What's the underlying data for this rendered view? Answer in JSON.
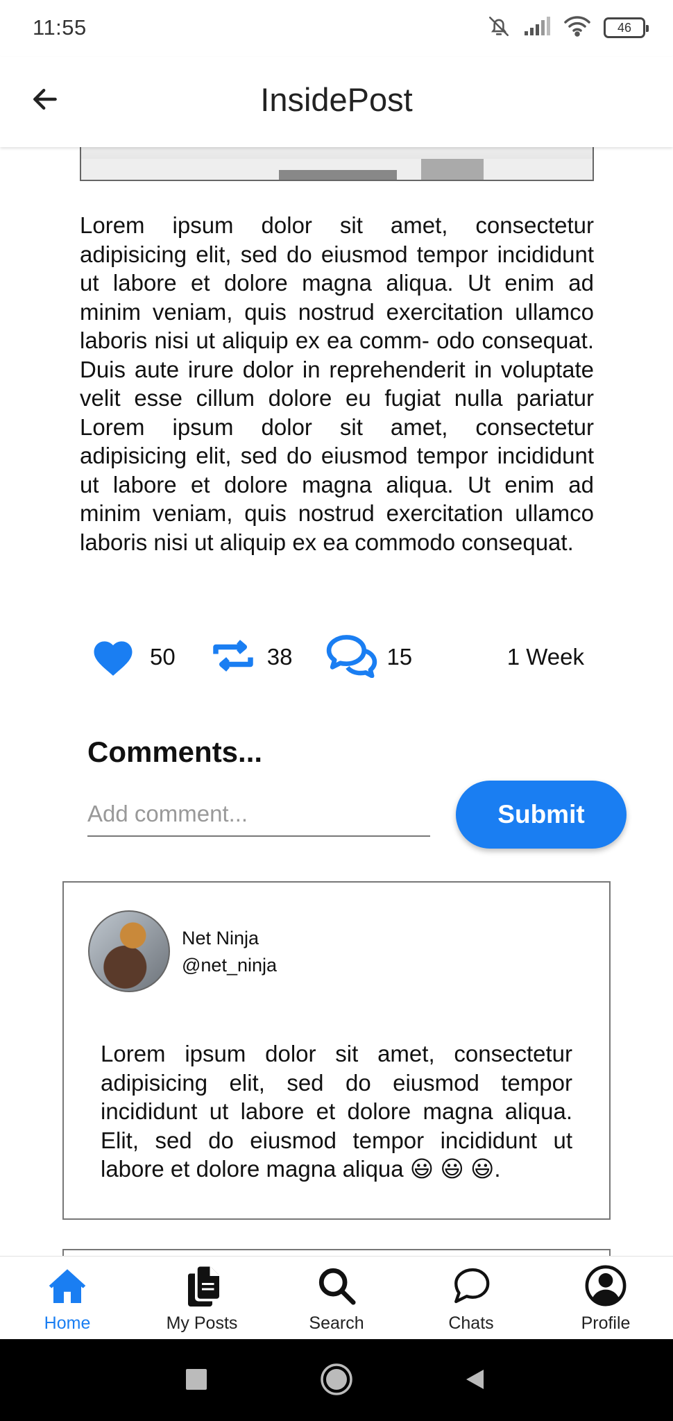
{
  "status_bar": {
    "time": "11:55",
    "battery_level": "46",
    "icons": [
      "bell-off-icon",
      "signal-icon",
      "wifi-icon",
      "battery-icon"
    ]
  },
  "app_bar": {
    "title": "InsidePost",
    "back_icon": "arrow-left-icon"
  },
  "post": {
    "body": "Lorem ipsum dolor sit amet, consectetur adipisicing elit, sed do eiusmod tempor incididunt ut labore et dolore magna aliqua. Ut enim ad minim veniam, quis nostrud exercitation ullamco laboris nisi ut aliquip ex ea comm- odo consequat. Duis aute irure dolor in reprehenderit in voluptate velit esse cillum dolore eu fugiat nulla pariatur Lorem ipsum dolor sit amet, consectetur adipisicing elit, sed do eiusmod tempor incididunt ut labore et dolore magna aliqua. Ut enim ad minim veniam, quis nostrud exercitation ullamco laboris nisi ut aliquip ex ea commodo consequat.",
    "likes": "50",
    "reposts": "38",
    "comments": "15",
    "time_ago": "1 Week"
  },
  "comments_section": {
    "heading": "Comments...",
    "input_placeholder": "Add comment...",
    "input_value": "",
    "submit_label": "Submit"
  },
  "comments": [
    {
      "name": "Net Ninja",
      "handle": "@net_ninja",
      "text": "Lorem ipsum dolor sit amet, consectetur adipisicing elit, sed do eiusmod tempor incididunt ut labore et dolore magna aliqua. Elit, sed do eiusmod tempor incididunt ut labore et dolore magna aliqua 😃 😃 😃."
    }
  ],
  "bottom_nav": {
    "items": [
      {
        "label": "Home",
        "icon": "home-icon",
        "active": true
      },
      {
        "label": "My Posts",
        "icon": "documents-icon",
        "active": false
      },
      {
        "label": "Search",
        "icon": "search-icon",
        "active": false
      },
      {
        "label": "Chats",
        "icon": "chat-bubble-icon",
        "active": false
      },
      {
        "label": "Profile",
        "icon": "user-circle-icon",
        "active": false
      }
    ]
  },
  "colors": {
    "accent": "#1a7ef2",
    "text": "#111111",
    "border": "#777777"
  }
}
